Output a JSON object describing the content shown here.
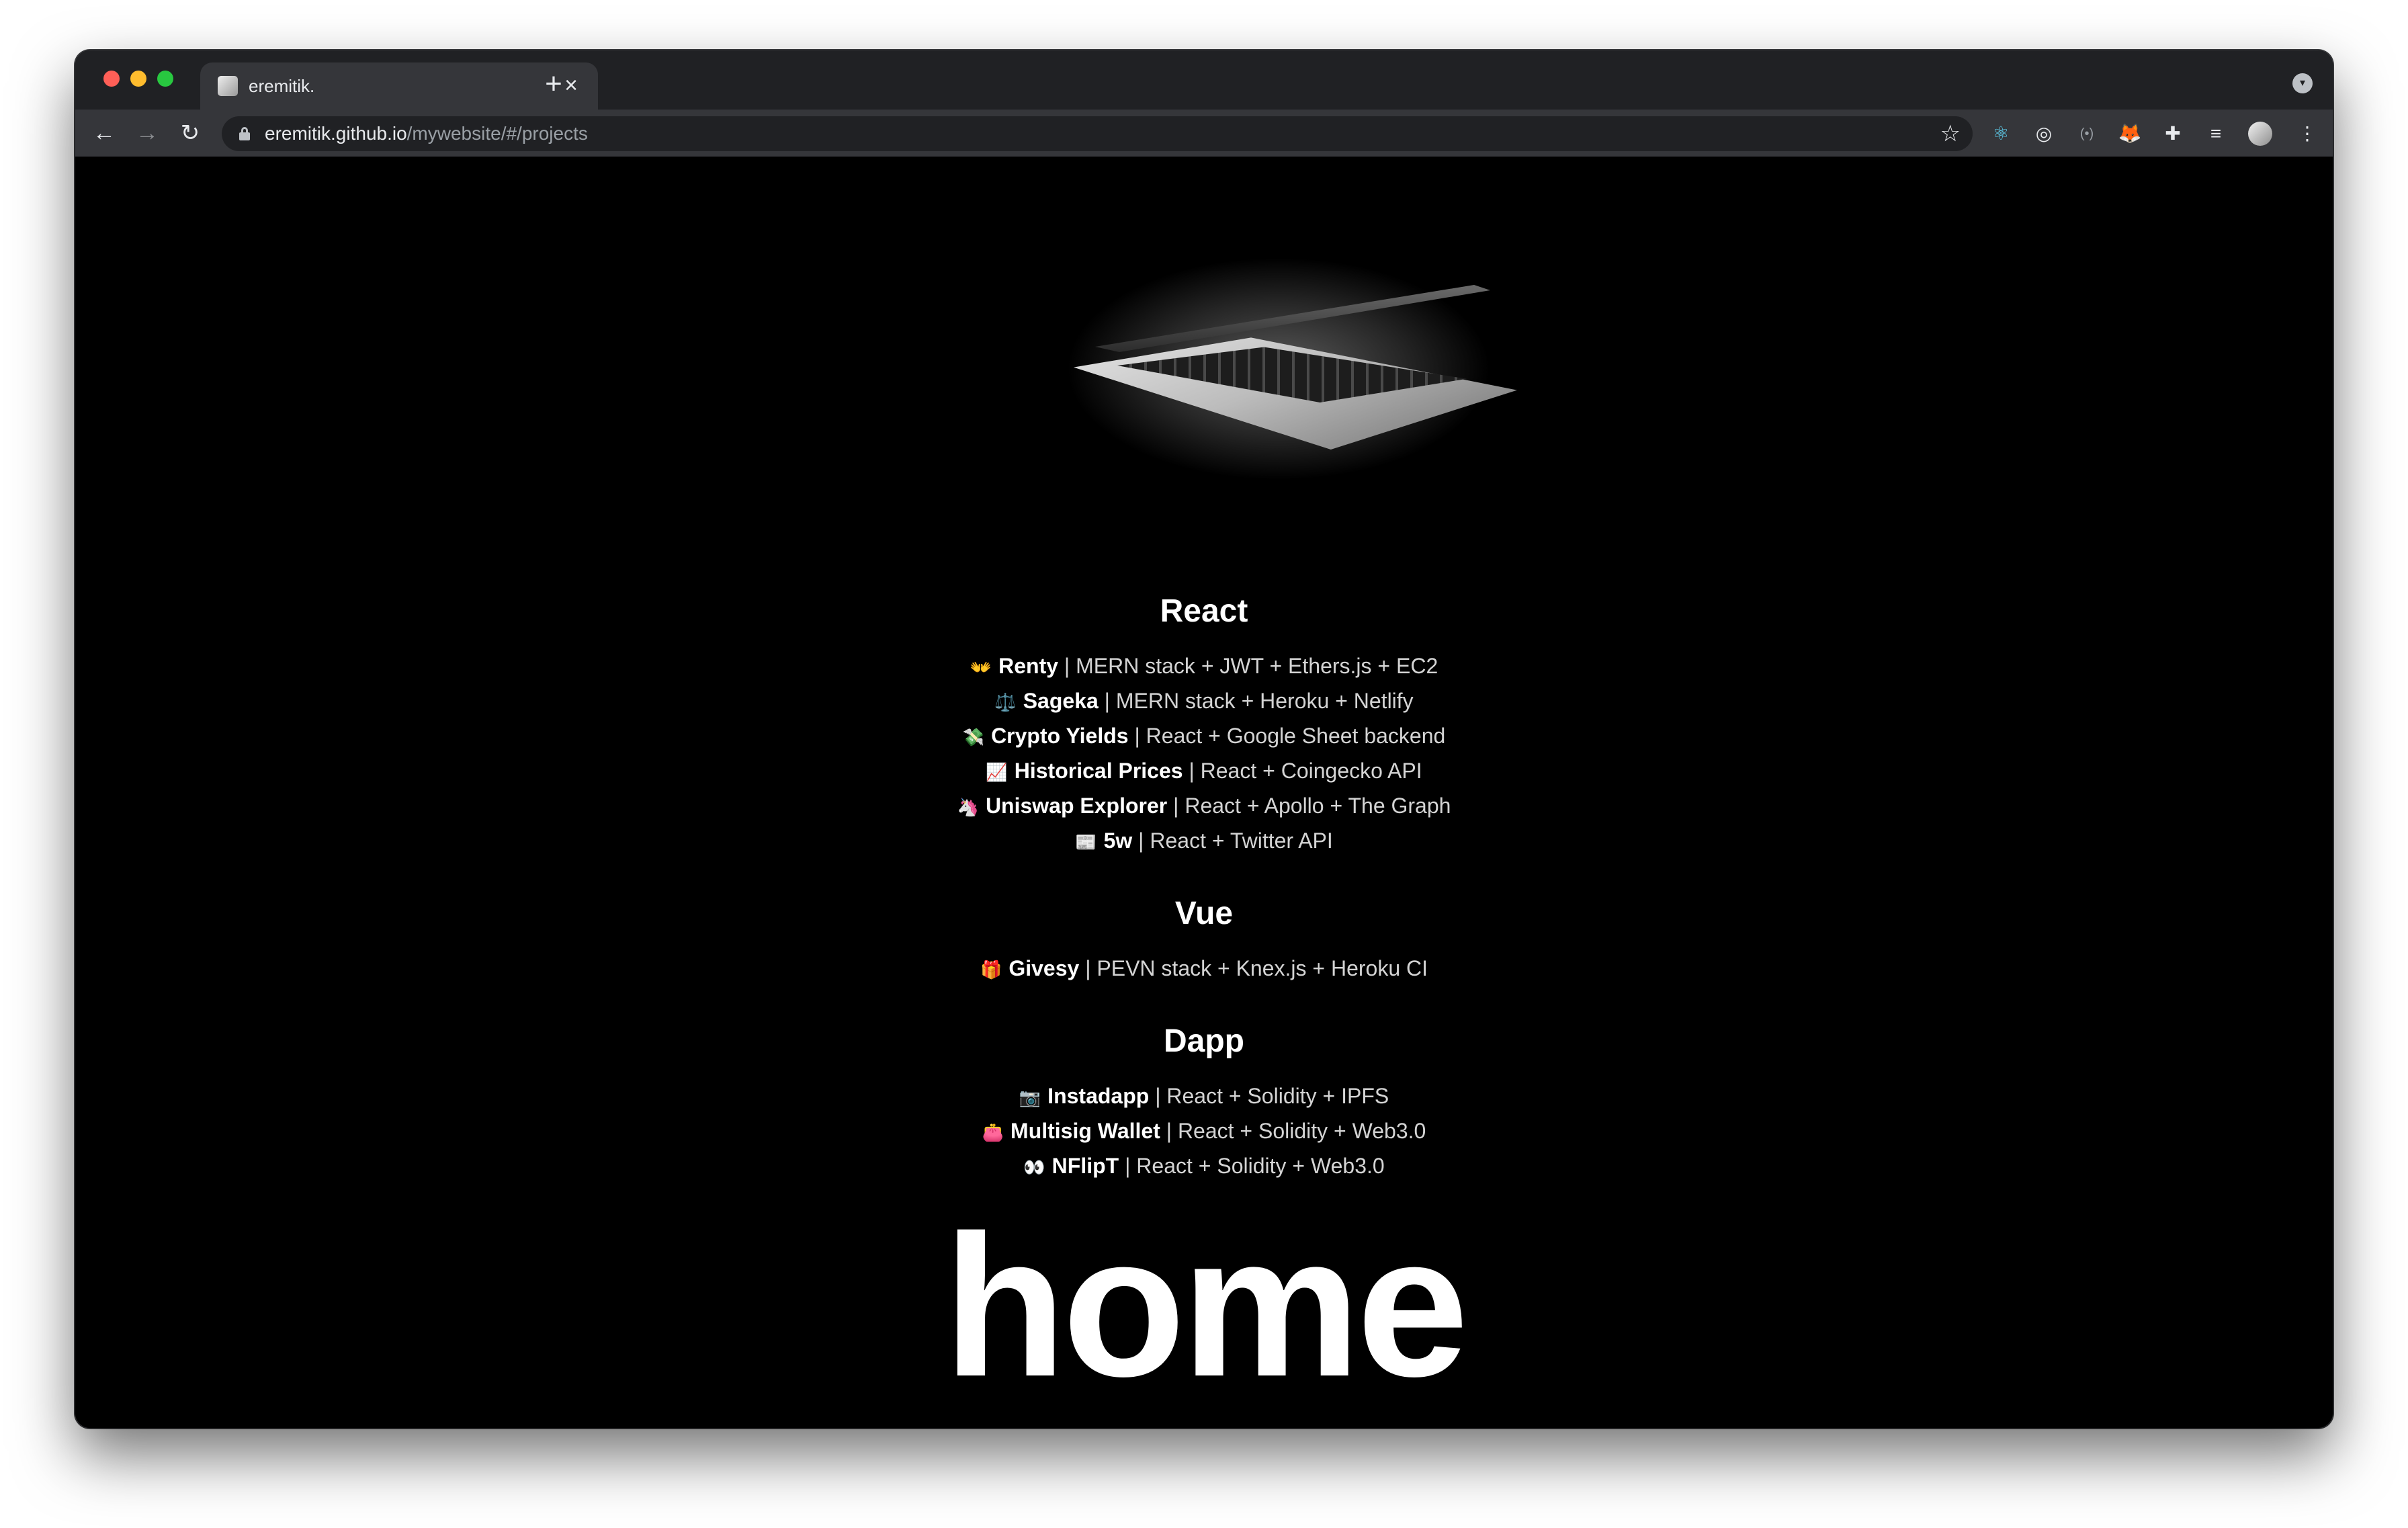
{
  "browser": {
    "tab_title": "eremitik.",
    "tab_close_icon": "×",
    "new_tab_icon": "+",
    "url_host": "eremitik.github.io",
    "url_path": "/mywebsite/#/projects"
  },
  "icons": {
    "back": "←",
    "forward": "→",
    "reload": "↻",
    "star": "☆",
    "react_ext": "⚛",
    "target_ext": "◎",
    "bracket_ext": "(•)",
    "fox_ext": "🦊",
    "puzzle_ext": "✚",
    "queue_ext": "≡",
    "menu": "⋮",
    "tab_search": "▾"
  },
  "sections": [
    {
      "title": "React",
      "projects": [
        {
          "emoji": "👐",
          "name": "Renty",
          "stack": " | MERN stack + JWT + Ethers.js + EC2"
        },
        {
          "emoji": "⚖️",
          "name": "Sageka",
          "stack": " | MERN stack + Heroku + Netlify"
        },
        {
          "emoji": "💸",
          "name": "Crypto Yields",
          "stack": " | React + Google Sheet backend"
        },
        {
          "emoji": "📈",
          "name": "Historical Prices",
          "stack": " | React + Coingecko API"
        },
        {
          "emoji": "🦄",
          "name": "Uniswap Explorer",
          "stack": " | React + Apollo + The Graph"
        },
        {
          "emoji": "📰",
          "name": "5w",
          "stack": " | React + Twitter API"
        }
      ]
    },
    {
      "title": "Vue",
      "projects": [
        {
          "emoji": "🎁",
          "name": "Givesy",
          "stack": " | PEVN stack + Knex.js + Heroku CI"
        }
      ]
    },
    {
      "title": "Dapp",
      "projects": [
        {
          "emoji": "📷",
          "name": "Instadapp",
          "stack": " | React + Solidity + IPFS"
        },
        {
          "emoji": "👛",
          "name": "Multisig Wallet",
          "stack": " | React + Solidity + Web3.0"
        },
        {
          "emoji": "👀",
          "name": "NFlipT",
          "stack": " | React + Solidity + Web3.0"
        }
      ]
    }
  ],
  "home_link": "home"
}
